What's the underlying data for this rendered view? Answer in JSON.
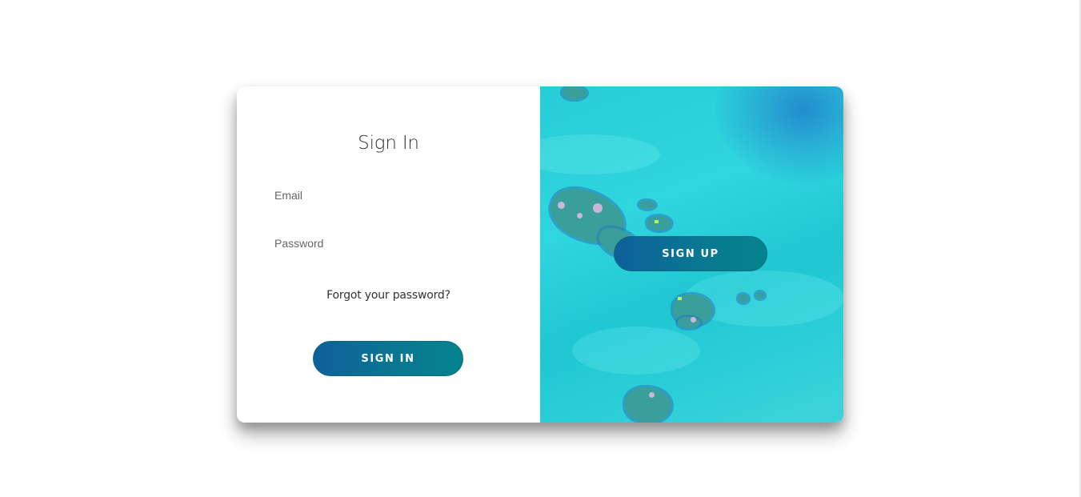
{
  "signin": {
    "title": "Sign In",
    "email_placeholder": "Email",
    "password_placeholder": "Password",
    "forgot_link": "Forgot your password?",
    "submit_label": "SIGN IN"
  },
  "overlay": {
    "signup_label": "SIGN UP"
  },
  "colors": {
    "button_gradient_start": "#0e5f9c",
    "button_gradient_end": "#04848e",
    "overlay_water": "#2fd6de"
  }
}
